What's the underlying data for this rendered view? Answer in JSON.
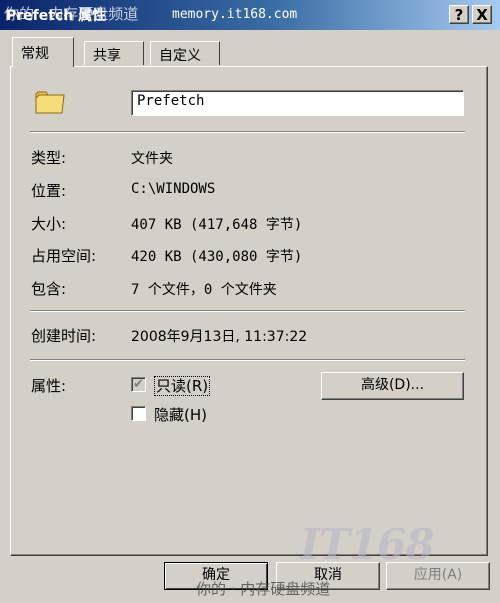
{
  "window": {
    "title": "Prefetch 属性",
    "watermark": "你的 · 内存硬盘频道",
    "site": "memory.it168.com",
    "help_label": "?",
    "close_label": "X"
  },
  "tabs": [
    {
      "label": "常规",
      "active": true
    },
    {
      "label": "共享",
      "active": false
    },
    {
      "label": "自定义",
      "active": false
    }
  ],
  "general": {
    "name_value": "Prefetch",
    "icon": "folder-icon",
    "fields": {
      "type": {
        "label": "类型:",
        "value": "文件夹"
      },
      "location": {
        "label": "位置:",
        "value": "C:\\WINDOWS"
      },
      "size": {
        "label": "大小:",
        "value": "407 KB (417,648 字节)"
      },
      "size_on_disk": {
        "label": "占用空间:",
        "value": "420 KB (430,080 字节)"
      },
      "contains": {
        "label": "包含:",
        "value": "7 个文件，0 个文件夹"
      },
      "created": {
        "label": "创建时间:",
        "value": "2008年9月13日, 11:37:22"
      }
    },
    "attributes": {
      "label": "属性:",
      "readonly": {
        "text": "只读",
        "mnemonic": "(R)",
        "checked": true
      },
      "hidden": {
        "text": "隐藏",
        "mnemonic": "(H)",
        "checked": false
      },
      "advanced_label": "高级(D)..."
    }
  },
  "footer": {
    "ok_label": "确定",
    "cancel_label": "取消",
    "apply_label": "应用(A)",
    "watermark_text": "你的 · 内存硬盘频道",
    "watermark_logo": "IT168"
  },
  "colors": {
    "dialog_bg": "#d4d0c8",
    "title_gradient_start": "#0a246a",
    "title_gradient_end": "#a6caf0"
  }
}
